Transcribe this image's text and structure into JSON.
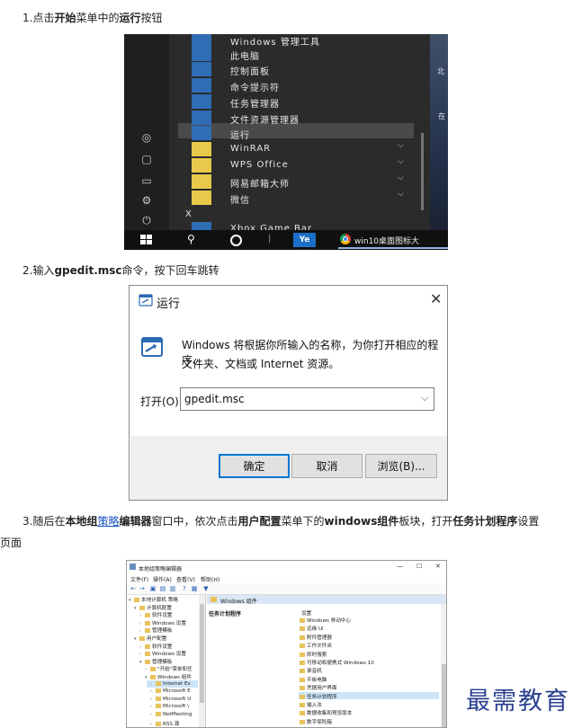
{
  "steps": [
    {
      "parts": [
        "1.点击",
        "开始",
        "菜单中的",
        "运行",
        "按钮"
      ]
    },
    {
      "parts": [
        "2.输入",
        "gpedit.msc",
        "命令，按下回车跳转"
      ]
    },
    {
      "parts": [
        "3.随后在",
        "本地组",
        "策略",
        "编辑器",
        "窗口中，依次点击",
        "用户配置",
        "菜单下的",
        "windows组件",
        "板块，打开",
        "任务计划程序",
        "设置"
      ]
    }
  ],
  "step3_wrap": "页面",
  "startmenu": {
    "items": [
      "Windows 管理工具",
      "此电脑",
      "控制面板",
      "命令提示符",
      "任务管理器",
      "文件资源管理器",
      "运行",
      "WinRAR",
      "WPS Office",
      "网易邮箱大师",
      "微信",
      "X",
      "Xbox Game Bar"
    ],
    "tile_colors": [
      "#2f6db5",
      "#2f6db5",
      "#2f6db5",
      "#2f6db5",
      "#2f6db5",
      "#2f6db5",
      "#2f6db5",
      "#e8c94a",
      "#e8c94a",
      "#e8c94a",
      "#e8c94a",
      "",
      "#2f6db5"
    ],
    "wallpaper_a": "北",
    "wallpaper_b": "在",
    "taskbar_app": "Ye",
    "taskbar_window": "win10桌面图标大"
  },
  "run_dialog": {
    "title": "运行",
    "close": "✕",
    "description_line1": "Windows 将根据你所输入的名称，为你打开相应的程序、",
    "description_line2": "文件夹、文档或 Internet 资源。",
    "open_label": "打开(O):",
    "open_value": "gpedit.msc",
    "ok": "确定",
    "cancel": "取消",
    "browse": "浏览(B)..."
  },
  "gpedit": {
    "title": "本地组策略编辑器",
    "menus": [
      "文件(F)",
      "操作(A)",
      "查看(V)",
      "帮助(H)"
    ],
    "tree": [
      {
        "label": "本地计算机 策略",
        "indent": 0,
        "twisty": "▾"
      },
      {
        "label": "计算机配置",
        "indent": 1,
        "twisty": "▾"
      },
      {
        "label": "软件设置",
        "indent": 2,
        "twisty": "›"
      },
      {
        "label": "Windows 设置",
        "indent": 2,
        "twisty": "›"
      },
      {
        "label": "管理模板",
        "indent": 2,
        "twisty": "›"
      },
      {
        "label": "用户配置",
        "indent": 1,
        "twisty": "▾"
      },
      {
        "label": "软件设置",
        "indent": 2,
        "twisty": "›"
      },
      {
        "label": "Windows 设置",
        "indent": 2,
        "twisty": "›"
      },
      {
        "label": "管理模板",
        "indent": 2,
        "twisty": "▾"
      },
      {
        "label": "\"开始\"菜单和任",
        "indent": 3,
        "twisty": "›"
      },
      {
        "label": "Windows 组件",
        "indent": 3,
        "twisty": "▾"
      },
      {
        "label": "Internet Ex",
        "indent": 4,
        "twisty": "›"
      },
      {
        "label": "Microsoft E",
        "indent": 4,
        "twisty": "›"
      },
      {
        "label": "Microsoft U",
        "indent": 4,
        "twisty": "›"
      },
      {
        "label": "Microsoft \\",
        "indent": 4,
        "twisty": "›"
      },
      {
        "label": "NetMeeting",
        "indent": 4,
        "twisty": "›"
      },
      {
        "label": "RSS 源",
        "indent": 4,
        "twisty": "›"
      }
    ],
    "header": "Windows 组件",
    "left_heading": "任务计划程序",
    "column_header": "设置",
    "list": [
      "Windows 移动中心",
      "远缘 UI",
      "附件管理器",
      "工作文件夹",
      "即时搜索",
      "可移动和便携式 Windows 10",
      "录音机",
      "平板电脑",
      "凭据用户界面",
      "任务计划程序",
      "输入法",
      "数据收集和预览版本",
      "数字保险箱"
    ],
    "selected_list_index": 9
  },
  "watermark": "最需教育"
}
